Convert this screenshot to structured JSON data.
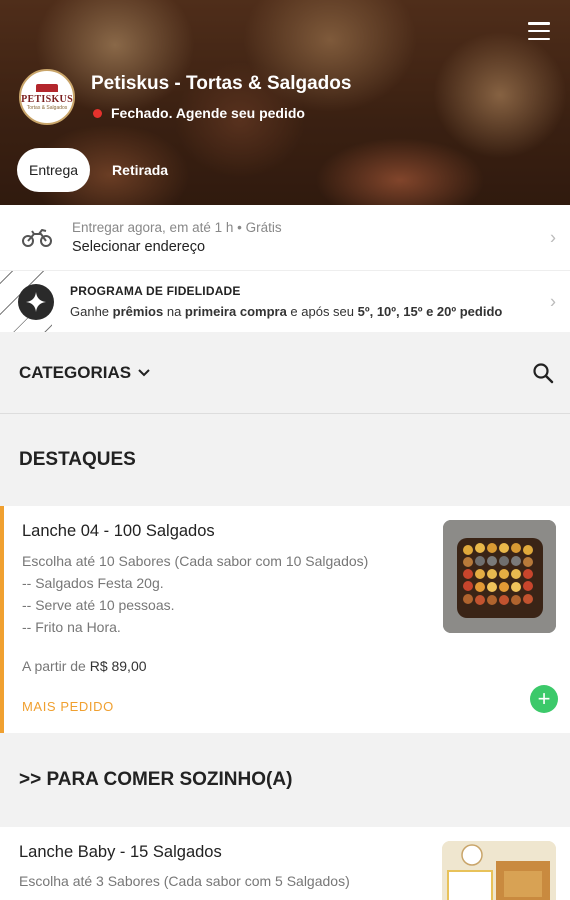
{
  "header": {
    "shop_name": "Petiskus - Tortas & Salgados",
    "status": "Fechado. Agende seu pedido",
    "logo_text": "PETISKUS",
    "logo_subtext": "Tortas & Salgados",
    "tabs": [
      {
        "label": "Entrega",
        "active": true
      },
      {
        "label": "Retirada",
        "active": false
      }
    ]
  },
  "delivery": {
    "line1": "Entregar agora, em até 1 h • Grátis",
    "line2": "Selecionar endereço"
  },
  "loyalty": {
    "title": "PROGRAMA DE FIDELIDADE",
    "desc_1": "Ganhe ",
    "desc_2": "prêmios",
    "desc_3": " na ",
    "desc_4": "primeira compra",
    "desc_5": " e após seu ",
    "desc_6": "5º, 10º, 15º e 20º pedido"
  },
  "categories": {
    "label": "CATEGORIAS"
  },
  "sections": [
    {
      "title": "DESTAQUES",
      "products": [
        {
          "name": "Lanche 04 - 100 Salgados",
          "desc": [
            "Escolha até 10 Sabores (Cada sabor com 10 Salgados)",
            "-- Salgados Festa 20g.",
            "-- Serve até 10 pessoas.",
            "-- Frito na Hora."
          ],
          "price_prefix": "A partir de ",
          "price": "R$ 89,00",
          "tag": "MAIS PEDIDO"
        }
      ]
    },
    {
      "title": ">> PARA COMER SOZINHO(A)",
      "products": [
        {
          "name": "Lanche Baby - 15 Salgados",
          "desc": [
            "Escolha até 3 Sabores (Cada sabor com 5 Salgados)"
          ]
        }
      ]
    }
  ],
  "colors": {
    "accent": "#f0a030",
    "add_button": "#3cc96a",
    "closed_dot": "#e5322d"
  }
}
